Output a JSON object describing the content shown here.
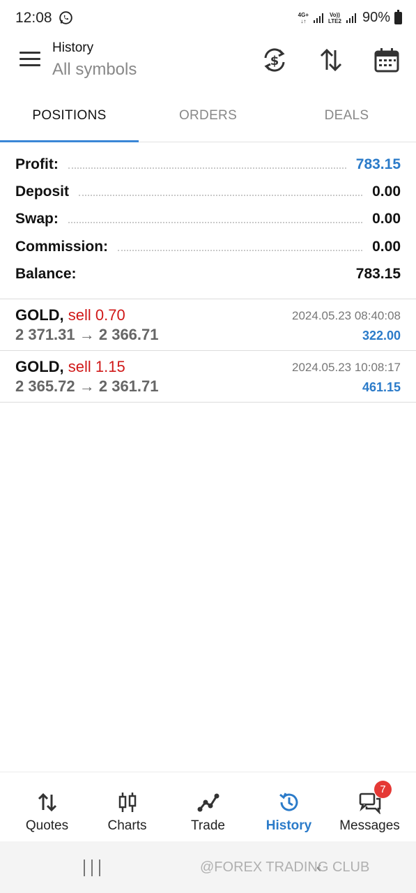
{
  "status_bar": {
    "time": "12:08",
    "net1_top": "4G+",
    "net1_bottom": "↓↑",
    "net2_top": "Vo))",
    "net2_bottom": "LTE2",
    "battery": "90%"
  },
  "header": {
    "title": "History",
    "subtitle": "All symbols",
    "icons": [
      "menu-icon",
      "currency-sync-icon",
      "sort-icon",
      "calendar-icon"
    ]
  },
  "tabs": [
    {
      "label": "POSITIONS",
      "active": true
    },
    {
      "label": "ORDERS",
      "active": false
    },
    {
      "label": "DEALS",
      "active": false
    }
  ],
  "summary": {
    "profit_label": "Profit:",
    "profit_value": "783.15",
    "deposit_label": "Deposit",
    "deposit_value": "0.00",
    "swap_label": "Swap:",
    "swap_value": "0.00",
    "commission_label": "Commission:",
    "commission_value": "0.00",
    "balance_label": "Balance:",
    "balance_value": "783.15"
  },
  "deals": [
    {
      "symbol": "GOLD,",
      "side": "sell 0.70",
      "prices": "2 371.31 → 2 366.71",
      "time": "2024.05.23 08:40:08",
      "profit": "322.00"
    },
    {
      "symbol": "GOLD,",
      "side": "sell 1.15",
      "prices": "2 365.72 → 2 361.71",
      "time": "2024.05.23 10:08:17",
      "profit": "461.15"
    }
  ],
  "bottom_nav": [
    {
      "label": "Quotes",
      "icon": "quotes-arrows-icon",
      "active": false
    },
    {
      "label": "Charts",
      "icon": "candlestick-icon",
      "active": false
    },
    {
      "label": "Trade",
      "icon": "trade-line-icon",
      "active": false
    },
    {
      "label": "History",
      "icon": "history-clock-icon",
      "active": true
    },
    {
      "label": "Messages",
      "icon": "messages-icon",
      "active": false,
      "badge": "7"
    }
  ],
  "system_nav": {
    "watermark": "@FOREX TRADING CLUB"
  },
  "colors": {
    "accent": "#2b7bc9",
    "sell": "#d01818",
    "badge": "#e53935",
    "tab_underline": "#3a86d6"
  }
}
